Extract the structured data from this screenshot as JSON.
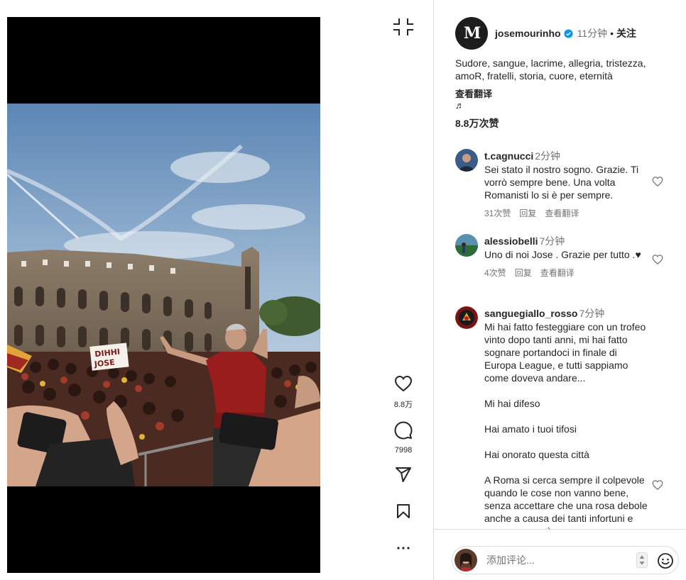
{
  "post": {
    "username": "josemourinho",
    "time": "11分钟",
    "separator": "•",
    "follow_label": "关注",
    "avatar_initials": "M",
    "caption": "Sudore, sangue, lacrime, allegria, tristezza, amoR, fratelli, storia, cuore, eternità",
    "see_translation": "查看翻译",
    "music_glyph": "♬",
    "likes": "8.8万次赞"
  },
  "actions": {
    "likes_count": "8.8万",
    "comments_count": "7998"
  },
  "icons": {
    "collapse": "collapse-icon",
    "heart": "heart-icon",
    "comment": "comment-icon",
    "share": "share-icon",
    "bookmark": "bookmark-icon",
    "more": "more-icon",
    "emoji": "emoji-icon",
    "verified": "verified-badge-icon"
  },
  "colors": {
    "verified_blue": "#0095f6",
    "text_primary": "#262626",
    "text_secondary": "#737373",
    "border": "#dbdbdb"
  },
  "comments": [
    {
      "username": "t.cagnucci",
      "time": "2分钟",
      "text": "Sei stato il nostro sogno. Grazie. Ti vorrò sempre bene. Una volta Romanisti lo si è per sempre.",
      "likes": "31次赞",
      "reply": "回复",
      "translate": "查看翻译"
    },
    {
      "username": "alessiobelli",
      "time": "7分钟",
      "text": "Uno di noi Jose . Grazie per tutto .♥",
      "likes": "4次赞",
      "reply": "回复",
      "translate": "查看翻译"
    },
    {
      "username": "sanguegiallo_rosso",
      "time": "7分钟",
      "text": "Mi hai fatto festeggiare con un trofeo vinto dopo tanti anni, mi hai fatto sognare portandoci in finale di Europa League, e tutti sappiamo come doveva andare...\n\nMi hai difeso\n\nHai amato i tuoi tifosi\n\nHai onorato questa città\n\nA Roma si cerca sempre il colpevole quando le cose non vanno bene, senza accettare che una rosa debole anche a causa dei tanti infortuni e assenze, non è"
    }
  ],
  "composer": {
    "placeholder": "添加评论..."
  },
  "photo": {
    "banner_text": "DIHHI JOSE"
  }
}
